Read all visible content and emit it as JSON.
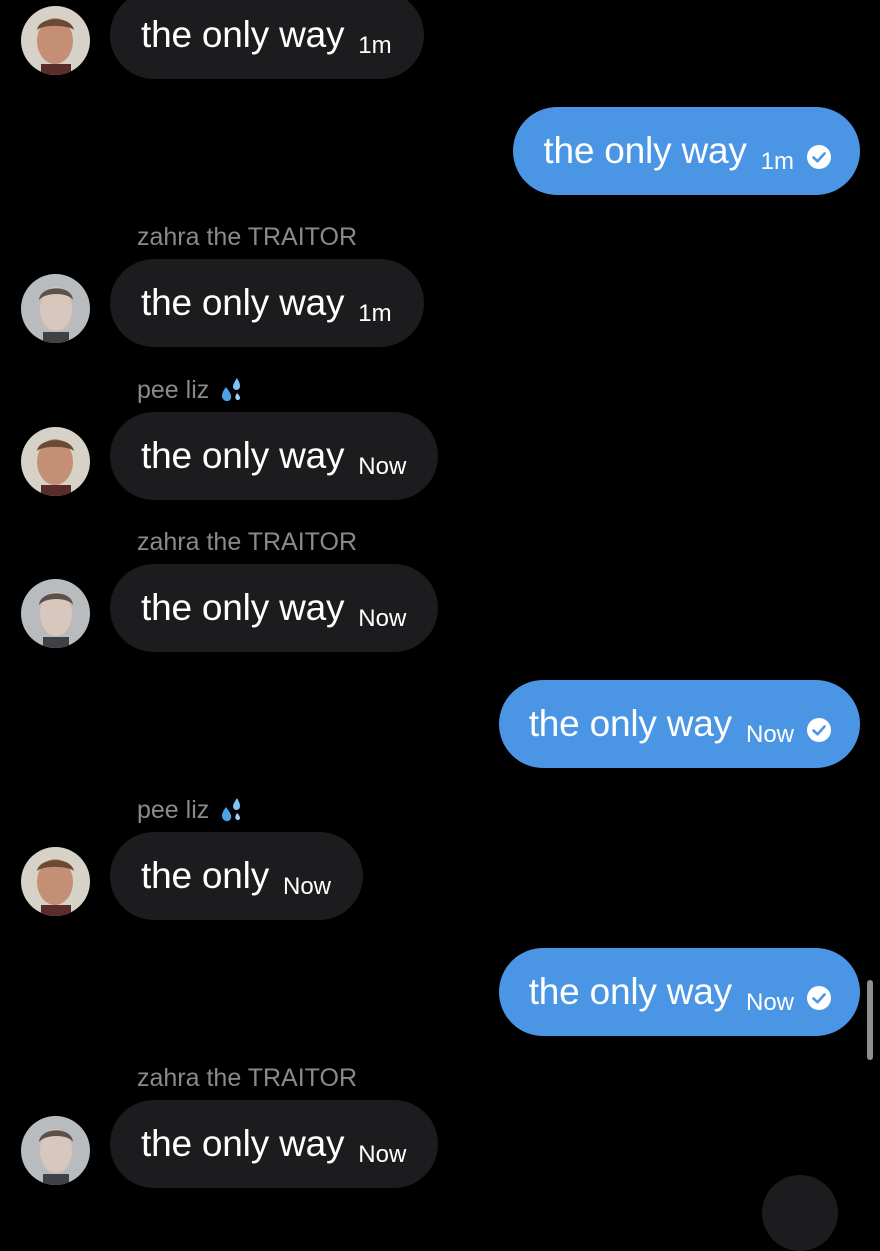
{
  "messages": [
    {
      "dir": "in",
      "sender": "",
      "avatar": "avatar-a",
      "text": "the only way",
      "time": "1m"
    },
    {
      "dir": "out",
      "text": "the only way",
      "time": "1m"
    },
    {
      "dir": "in",
      "sender": "zahra the TRAITOR",
      "avatar": "avatar-b",
      "text": "the only way",
      "time": "1m"
    },
    {
      "dir": "in",
      "sender": "pee liz",
      "sender_icon": "sweat-droplets-icon",
      "avatar": "avatar-a",
      "text": "the only way",
      "time": "Now"
    },
    {
      "dir": "in",
      "sender": "zahra the TRAITOR",
      "avatar": "avatar-b",
      "text": "the only way",
      "time": "Now"
    },
    {
      "dir": "out",
      "text": "the only way",
      "time": "Now"
    },
    {
      "dir": "in",
      "sender": "pee liz",
      "sender_icon": "sweat-droplets-icon",
      "avatar": "avatar-a",
      "text": "the only",
      "time": "Now"
    },
    {
      "dir": "out",
      "text": "the only way",
      "time": "Now"
    },
    {
      "dir": "in",
      "sender": "zahra the TRAITOR",
      "avatar": "avatar-b",
      "text": "the only way",
      "time": "Now"
    }
  ],
  "colors": {
    "background": "#000000",
    "incoming_bubble": "#1c1c1e",
    "outgoing_bubble": "#4b96e4",
    "sender_name": "#8a8a8e"
  }
}
